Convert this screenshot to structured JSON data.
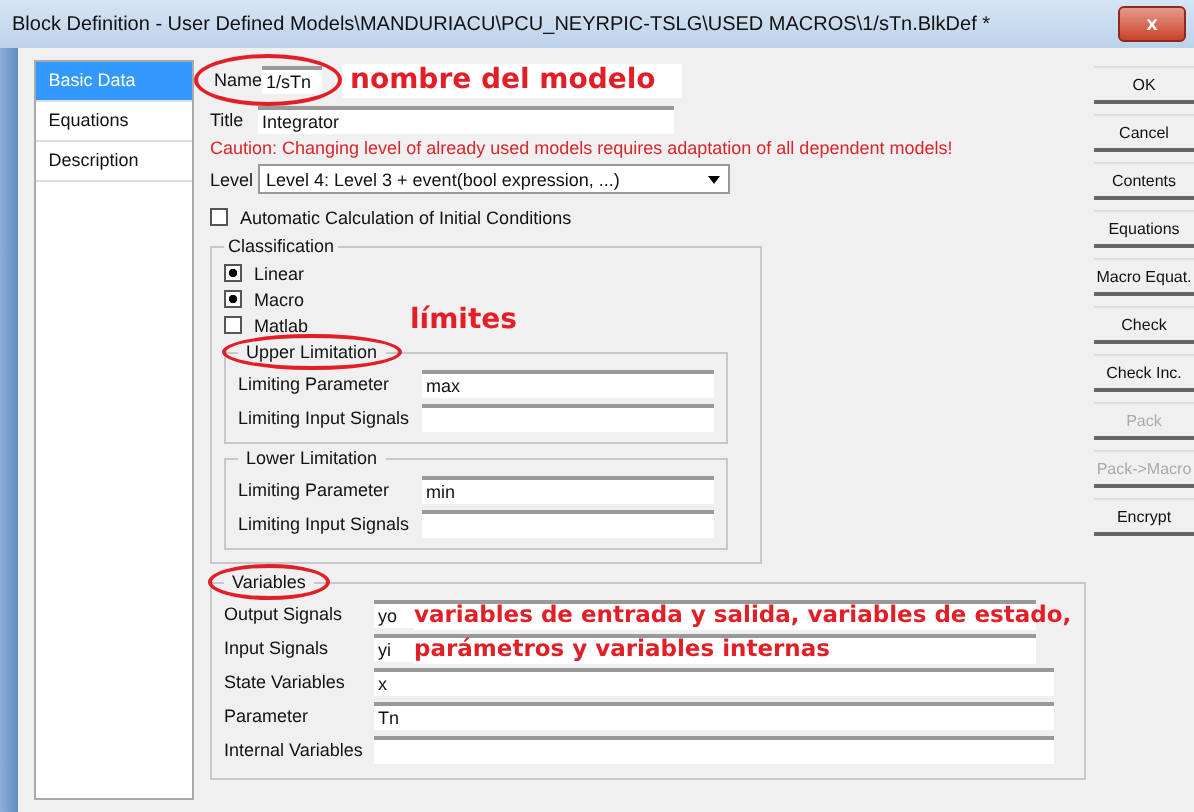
{
  "window": {
    "title": "Block Definition - User Defined Models\\MANDURIACU\\PCU_NEYRPIC-TSLG\\USED MACROS\\1/sTn.BlkDef *",
    "close": "x"
  },
  "sidebar": {
    "items": [
      {
        "label": "Basic Data",
        "selected": true
      },
      {
        "label": "Equations",
        "selected": false
      },
      {
        "label": "Description",
        "selected": false
      }
    ]
  },
  "form": {
    "name": {
      "label": "Name",
      "value": "1/sTn",
      "circled": true
    },
    "title": {
      "label": "Title",
      "value": "Integrator"
    },
    "caution": "Caution: Changing level of already used models requires adaptation of all dependent models!",
    "level": {
      "label": "Level",
      "value": "Level 4: Level 3 + event(bool expression, ...)"
    },
    "auto_init": {
      "label": "Automatic Calculation of Initial Conditions",
      "checked": false
    },
    "classification": {
      "legend": "Classification",
      "items": [
        {
          "label": "Linear",
          "checked": true
        },
        {
          "label": "Macro",
          "checked": true
        },
        {
          "label": "Matlab",
          "checked": false
        }
      ]
    },
    "limits": [
      {
        "legend": "Upper Limitation",
        "circled": true,
        "rows": [
          {
            "label": "Limiting Parameter",
            "value": "max"
          },
          {
            "label": "Limiting Input Signals",
            "value": ""
          }
        ]
      },
      {
        "legend": "Lower Limitation",
        "circled": false,
        "rows": [
          {
            "label": "Limiting Parameter",
            "value": "min"
          },
          {
            "label": "Limiting Input Signals",
            "value": ""
          }
        ]
      }
    ],
    "variables": {
      "legend": "Variables",
      "circled": true,
      "rows": [
        {
          "label": "Output Signals",
          "value": "yo"
        },
        {
          "label": "Input Signals",
          "value": "yi"
        },
        {
          "label": "State Variables",
          "value": "x"
        },
        {
          "label": "Parameter",
          "value": "Tn"
        },
        {
          "label": "Internal Variables",
          "value": ""
        }
      ]
    }
  },
  "buttons": [
    {
      "label": "OK",
      "disabled": false
    },
    {
      "label": "Cancel",
      "disabled": false
    },
    {
      "label": "Contents",
      "disabled": false
    },
    {
      "label": "Equations",
      "disabled": false
    },
    {
      "label": "Macro Equat.",
      "disabled": false
    },
    {
      "label": "Check",
      "disabled": false
    },
    {
      "label": "Check Inc.",
      "disabled": false
    },
    {
      "label": "Pack",
      "disabled": true
    },
    {
      "label": "Pack->Macro",
      "disabled": true
    },
    {
      "label": "Encrypt",
      "disabled": false
    }
  ],
  "annotations": [
    {
      "text": "nombre del modelo"
    },
    {
      "text": "límites"
    },
    {
      "text": "variables de entrada y salida, variables de estado,"
    },
    {
      "text": "parámetros y variables internas"
    }
  ]
}
